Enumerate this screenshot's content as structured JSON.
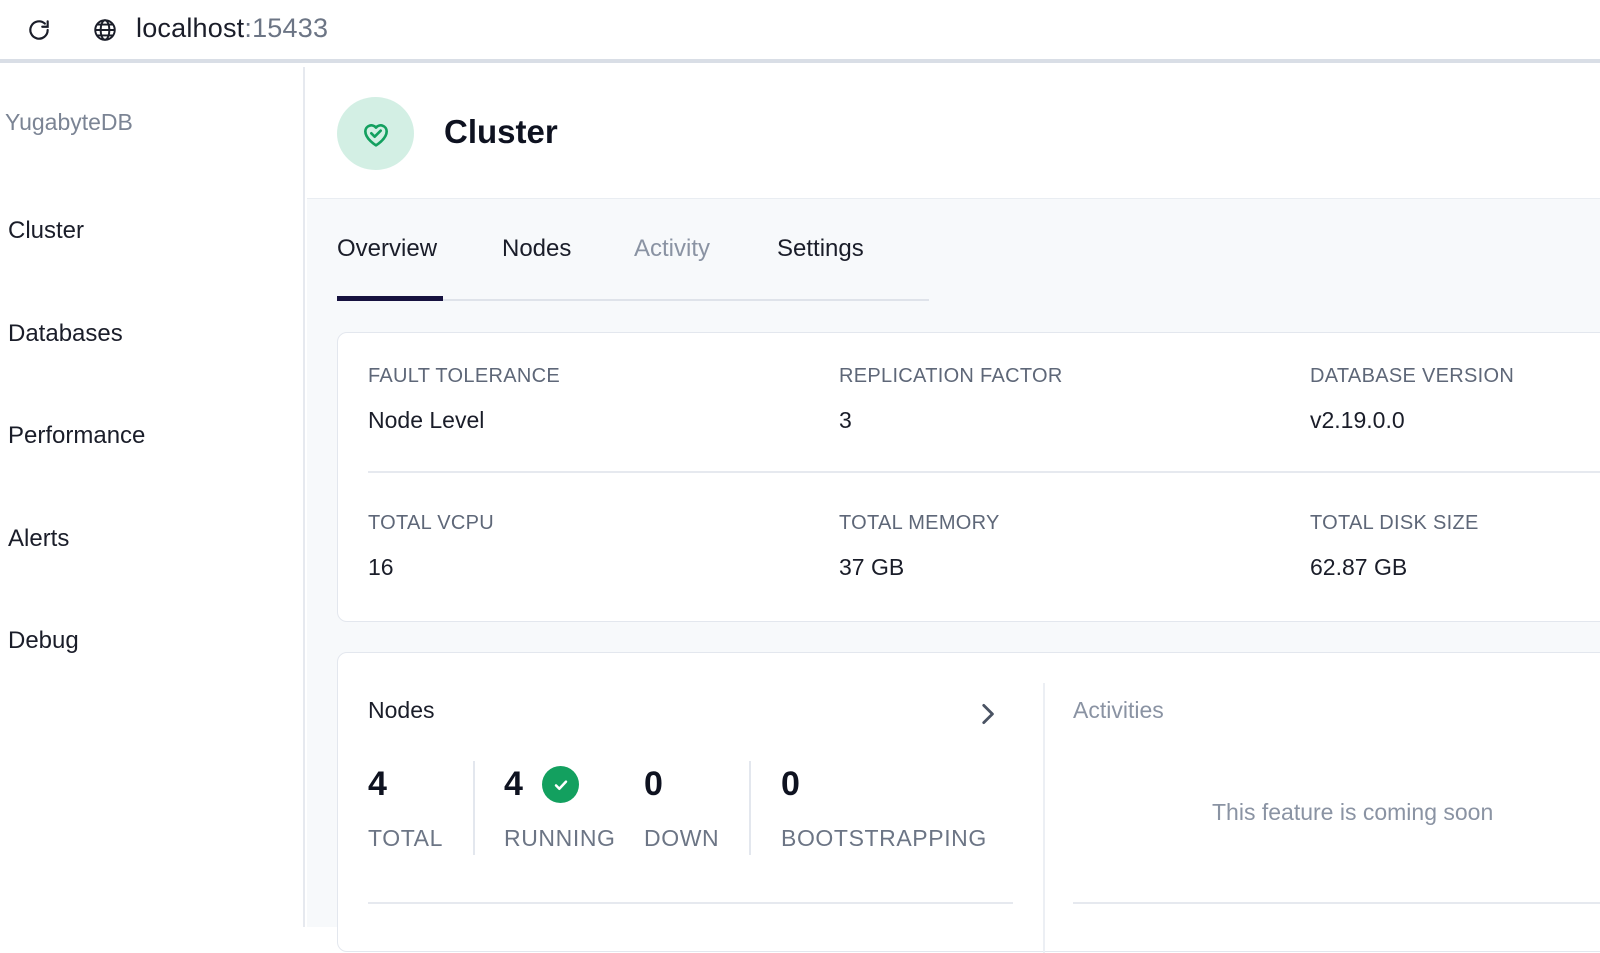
{
  "browser": {
    "url_host": "localhost",
    "url_port": ":15433"
  },
  "sidebar": {
    "brand": "YugabyteDB",
    "items": [
      {
        "label": "Cluster"
      },
      {
        "label": "Databases"
      },
      {
        "label": "Performance"
      },
      {
        "label": "Alerts"
      },
      {
        "label": "Debug"
      }
    ]
  },
  "header": {
    "title": "Cluster",
    "icon": "heart-check-icon"
  },
  "tabs": [
    {
      "label": "Overview",
      "state": "active"
    },
    {
      "label": "Nodes",
      "state": "normal"
    },
    {
      "label": "Activity",
      "state": "disabled"
    },
    {
      "label": "Settings",
      "state": "normal"
    }
  ],
  "overview": {
    "fault_tolerance_label": "FAULT TOLERANCE",
    "fault_tolerance_value": "Node Level",
    "replication_factor_label": "REPLICATION FACTOR",
    "replication_factor_value": "3",
    "database_version_label": "DATABASE VERSION",
    "database_version_value": "v2.19.0.0",
    "total_vcpu_label": "TOTAL VCPU",
    "total_vcpu_value": "16",
    "total_memory_label": "TOTAL MEMORY",
    "total_memory_value": "37 GB",
    "total_disk_label": "TOTAL DISK SIZE",
    "total_disk_value": "62.87 GB"
  },
  "nodes": {
    "title": "Nodes",
    "total_value": "4",
    "total_label": "TOTAL",
    "running_value": "4",
    "running_label": "RUNNING",
    "down_value": "0",
    "down_label": "DOWN",
    "bootstrapping_value": "0",
    "bootstrapping_label": "BOOTSTRAPPING"
  },
  "activities": {
    "title": "Activities",
    "message": "This feature is coming soon"
  },
  "colors": {
    "accent_navy": "#16123f",
    "success_green": "#13a05f",
    "heart_bg": "#d3efe4"
  }
}
